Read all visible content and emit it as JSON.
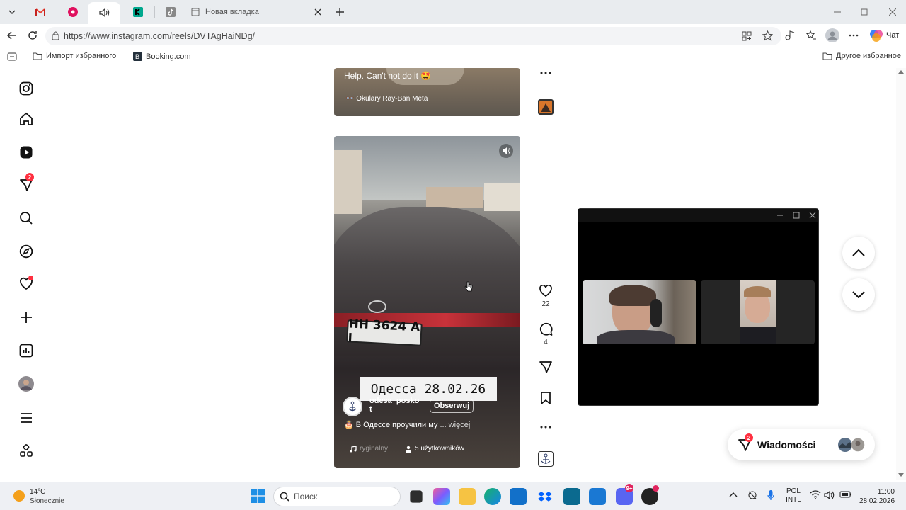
{
  "browser": {
    "tabs": [
      {
        "icon": "gmail-icon"
      },
      {
        "icon": "music-icon"
      },
      {
        "icon": "speaker-icon",
        "active": true
      },
      {
        "icon": "kaspersky-icon"
      },
      {
        "icon": "tiktok-icon"
      },
      {
        "label": "Новая вкладка"
      }
    ],
    "url": "https://www.instagram.com/reels/DVTAgHaiNDg/",
    "copilot_label": "Чат",
    "favorites": [
      "Импорт избранного",
      "Booking.com"
    ],
    "other_favorites": "Другое избранное"
  },
  "sidebar": {
    "items": [
      "instagram-logo",
      "home",
      "reels",
      "messages",
      "search",
      "explore",
      "notifications",
      "create",
      "dashboard",
      "profile",
      "more",
      "also-from-meta"
    ],
    "messages_badge": "2"
  },
  "prev_reel": {
    "caption": "Help. Can't not do it 🤩",
    "tag": "👓 Okulary Ray-Ban Meta"
  },
  "reel": {
    "overlay_text": "Одесса 28.02.26",
    "plate_text": "НН 3624 А І",
    "username": "odesa_posko t",
    "follow_label": "Obserwuj",
    "caption": "🎂 В Одессе проучили му",
    "more_label": "... więcej",
    "audio": "ryginalny",
    "users": "5 użytkowników",
    "likes": "22",
    "comments": "4"
  },
  "messages_pill": {
    "label": "Wiadomości",
    "badge": "2"
  },
  "taskbar": {
    "weather_temp": "14°C",
    "weather_desc": "Słonecznie",
    "search_placeholder": "Поиск",
    "lang_top": "POL",
    "lang_bottom": "INTL",
    "time": "11:00",
    "date": "28.02.2026",
    "discord_badge": "9+"
  },
  "colors": {
    "accent": "#ff3040",
    "link": "#0095f6"
  }
}
